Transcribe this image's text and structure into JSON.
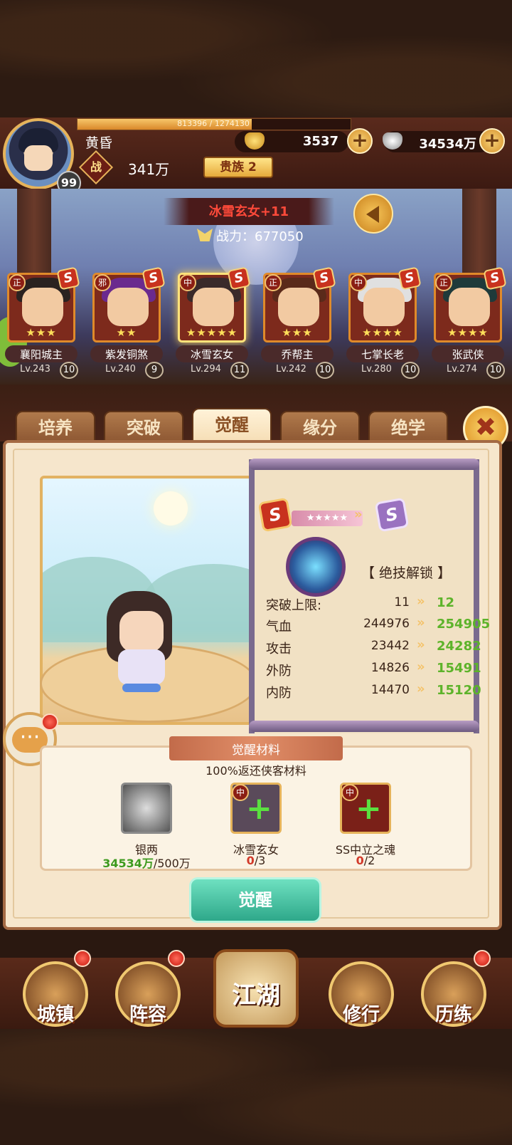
{
  "player": {
    "name": "黄昏",
    "level": "99",
    "exp_text": "813396 / 1274130",
    "exp_fraction": 0.638,
    "power_tag": "战",
    "power": "341万",
    "noble": "贵族 2",
    "gold": "3537",
    "silver": "34534万"
  },
  "hero_title": "冰雪玄女+11",
  "combat_power": "战力：677050",
  "heroes": [
    {
      "name": "襄阳城主",
      "level": "Lv.243",
      "rank": "10",
      "faction": "正",
      "stars": "★★★",
      "selected": false
    },
    {
      "name": "紫发铜煞",
      "level": "Lv.240",
      "rank": "9",
      "faction": "邪",
      "stars": "★★",
      "selected": false
    },
    {
      "name": "冰雪玄女",
      "level": "Lv.294",
      "rank": "11",
      "faction": "中",
      "stars": "★★★★★",
      "selected": true
    },
    {
      "name": "乔帮主",
      "level": "Lv.242",
      "rank": "10",
      "faction": "正",
      "stars": "★★★",
      "selected": false
    },
    {
      "name": "七掌长老",
      "level": "Lv.280",
      "rank": "10",
      "faction": "中",
      "stars": "★★★★",
      "selected": false
    },
    {
      "name": "张武侠",
      "level": "Lv.274",
      "rank": "10",
      "faction": "正",
      "stars": "★★★★",
      "selected": false
    }
  ],
  "tabs": [
    "培养",
    "突破",
    "觉醒",
    "缘分",
    "绝学"
  ],
  "active_tab": "觉醒",
  "close_label": "✖",
  "awaken": {
    "grade_current": "S",
    "grade_next": "S",
    "star_ribbon": "★★★★★",
    "skill_unlock": "【 绝技解锁 】",
    "stats": [
      {
        "label": "突破上限:",
        "current": "11",
        "next": "12"
      },
      {
        "label": "气血",
        "current": "244976",
        "next": "254905"
      },
      {
        "label": "攻击",
        "current": "23442",
        "next": "24282"
      },
      {
        "label": "外防",
        "current": "14826",
        "next": "15491"
      },
      {
        "label": "内防",
        "current": "14470",
        "next": "15120"
      }
    ]
  },
  "materials": {
    "title": "觉醒材料",
    "subtitle": "100%返还侠客材料",
    "items": [
      {
        "name": "银两",
        "have": "34534万",
        "need": "/500万"
      },
      {
        "name": "冰雪玄女",
        "have": "0",
        "need": "/3",
        "faction": "中"
      },
      {
        "name": "SS中立之魂",
        "have": "0",
        "need": "/2",
        "faction": "中"
      }
    ]
  },
  "awaken_button": "觉醒",
  "nav": [
    "城镇",
    "阵容",
    "江湖",
    "修行",
    "历练"
  ],
  "colors": {
    "accent_gold": "#e6b35a",
    "stat_increase": "#5db32a",
    "insufficient": "#d23a2a"
  }
}
